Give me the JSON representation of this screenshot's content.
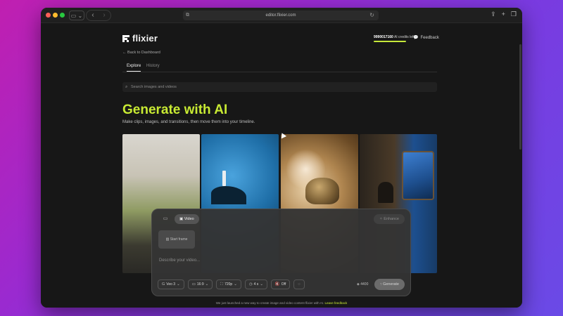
{
  "browser": {
    "url": "editor.flixier.com",
    "sidebar_icon": "sidebar-icon",
    "back_icon": "‹",
    "forward_icon": "›"
  },
  "app": {
    "logo_text": "flixier",
    "credits_value": "9990017160",
    "credits_label": "AI credits left",
    "feedback_label": "Feedback",
    "back_link": "Back to Dashboard",
    "tabs": [
      {
        "label": "Explore",
        "active": true
      },
      {
        "label": "History",
        "active": false
      }
    ],
    "search_placeholder": "Search images and videos",
    "hero_title": "Generate with AI",
    "hero_subtitle": "Make clips, images, and transitions, then move them into your timeline."
  },
  "generator": {
    "mode_video": "Video",
    "enhance_label": "Enhance",
    "start_frame_label": "Start frame",
    "describe_placeholder": "Describe your video...",
    "model": "Veo 3",
    "aspect": "16:9",
    "resolution": "720p",
    "duration": "4 s",
    "audio": "Off",
    "cost": "4400",
    "generate_label": "Generate"
  },
  "footer": {
    "text": "We just launched a new way to create image and video content flixier with AI.",
    "link": "Leave feedback"
  },
  "colors": {
    "accent": "#c8ea33",
    "background": "#171717"
  }
}
